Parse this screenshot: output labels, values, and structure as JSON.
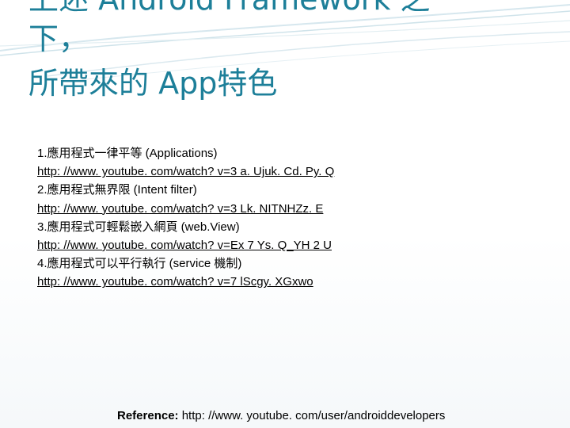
{
  "title": {
    "line1": "上述 Android Framework 之",
    "line2": "下，",
    "line3": "所帶來的 App特色"
  },
  "items": [
    {
      "text": "1.應用程式一律平等 (Applications)",
      "url": "http: //www. youtube. com/watch? v=3 a. Ujuk. Cd. Py. Q"
    },
    {
      "text": "2.應用程式無界限 (Intent filter)",
      "url": "http: //www. youtube. com/watch? v=3 Lk. NITNHZz. E"
    },
    {
      "text": "3.應用程式可輕鬆嵌入網頁 (web.View)",
      "url": "http: //www. youtube. com/watch? v=Ex 7 Ys. Q_YH 2 U"
    },
    {
      "text": "4.應用程式可以平行執行 (service 機制)",
      "url": "http: //www. youtube. com/watch? v=7 lScgy. XGxwo"
    }
  ],
  "reference": {
    "label": "Reference:",
    "url": "http: //www. youtube. com/user/androiddevelopers"
  },
  "colors": {
    "title": "#1d7f99",
    "decor": "#cfe3ea",
    "text": "#000000"
  }
}
